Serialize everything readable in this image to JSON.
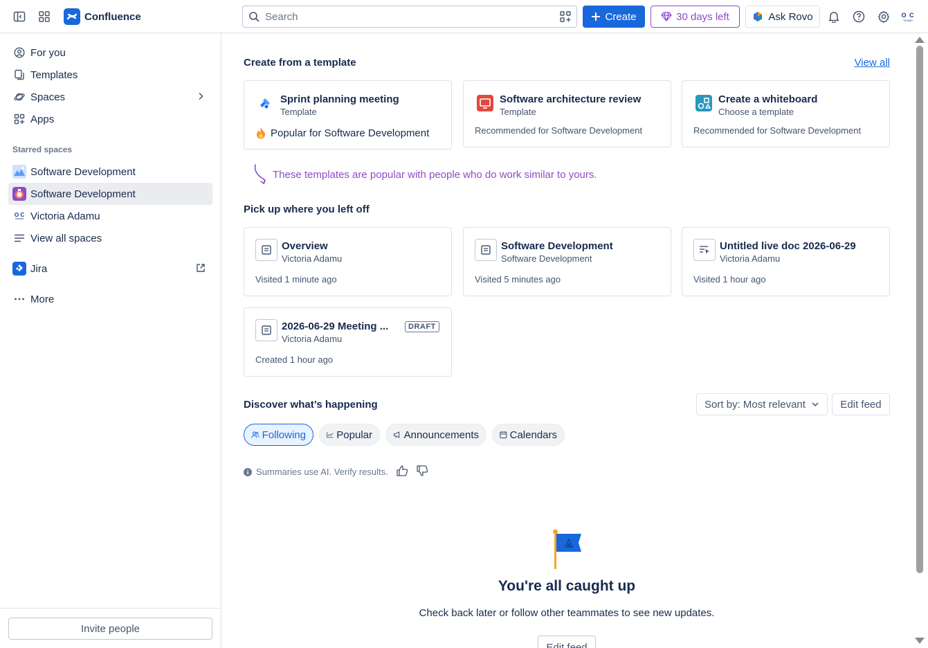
{
  "colors": {
    "brand": "#1868db",
    "trial": "#8f4bc8",
    "text": "#172b4d",
    "subtle": "#44546f"
  },
  "topbar": {
    "app_name": "Confluence",
    "search_placeholder": "Search",
    "create_label": "Create",
    "trial_label": "30 days left",
    "rovo_label": "Ask Rovo",
    "avatar_text_top": "O C",
    "avatar_text_bottom": "TEAMS"
  },
  "sidebar": {
    "items": [
      {
        "label": "For you",
        "icon": "person-circle-icon"
      },
      {
        "label": "Templates",
        "icon": "templates-icon"
      },
      {
        "label": "Spaces",
        "icon": "planet-icon"
      },
      {
        "label": "Apps",
        "icon": "apps-icon"
      }
    ],
    "starred_heading": "Starred spaces",
    "starred": [
      {
        "label": "Software Development",
        "icon": "mountain-space-icon"
      },
      {
        "label": "Software Development",
        "icon": "purple-space-icon",
        "active": true
      },
      {
        "label": "Victoria Adamu",
        "icon": "personal-space-icon"
      }
    ],
    "view_all_spaces": "View all spaces",
    "jira_label": "Jira",
    "more_label": "More",
    "invite_label": "Invite people"
  },
  "templates": {
    "title": "Create from a template",
    "view_all": "View all",
    "cards": [
      {
        "title": "Sprint planning meeting",
        "subtitle": "Template",
        "footer": "Popular for Software Development"
      },
      {
        "title": "Software architecture review",
        "subtitle": "Template",
        "footer": "Recommended for Software Development"
      },
      {
        "title": "Create a whiteboard",
        "subtitle": "Choose a template",
        "footer": "Recommended for Software Development"
      }
    ],
    "hint": "These templates are popular with people who do work similar to yours."
  },
  "recent": {
    "title": "Pick up where you left off",
    "cards": [
      {
        "title": "Overview",
        "subtitle": "Victoria Adamu",
        "footer": "Visited 1 minute ago"
      },
      {
        "title": "Software Development",
        "subtitle": "Software Development",
        "footer": "Visited 5 minutes ago"
      },
      {
        "title": "Untitled live doc 2026-06-29",
        "subtitle": "Victoria Adamu",
        "footer": "Visited 1 hour ago"
      },
      {
        "title": "2026-06-29 Meeting ...",
        "subtitle": "Victoria Adamu",
        "footer": "Created 1 hour ago",
        "badge": "DRAFT"
      }
    ]
  },
  "discover": {
    "title": "Discover what’s happening",
    "sort_label": "Sort by: Most relevant",
    "edit_feed": "Edit feed",
    "tabs": [
      {
        "label": "Following",
        "active": true
      },
      {
        "label": "Popular"
      },
      {
        "label": "Announcements"
      },
      {
        "label": "Calendars"
      }
    ],
    "ai_note": "Summaries use AI. Verify results.",
    "empty_title": "You're all caught up",
    "empty_sub": "Check back later or follow other teammates to see new updates.",
    "empty_button": "Edit feed"
  }
}
